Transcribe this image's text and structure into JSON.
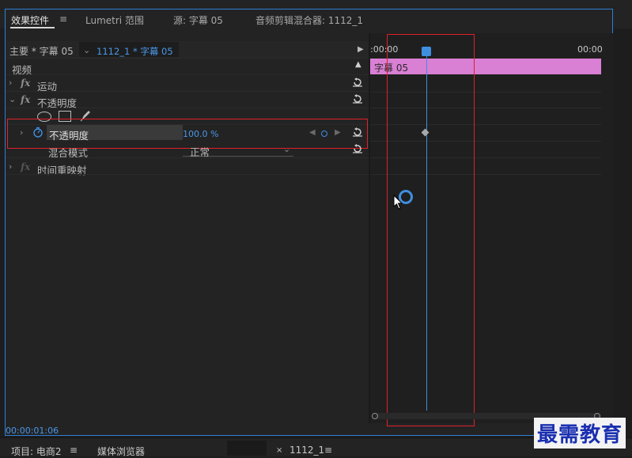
{
  "tabs": {
    "effect_controls": "效果控件",
    "lumetri": "Lumetri 范围",
    "source": "源: 字幕 05",
    "audio_mixer": "音频剪辑混合器: 1112_1",
    "menu_icon": "≡"
  },
  "source_header": {
    "master": "主要 * 字幕 05",
    "sequence": "1112_1 * 字幕 05"
  },
  "timeline": {
    "time_start": ":00:00",
    "time_end": "00:00",
    "clip_label": "字幕 05"
  },
  "effects": {
    "video_header": "视频",
    "motion": "运动",
    "opacity": "不透明度",
    "opacity_param": "不透明度",
    "opacity_value": "100.0 %",
    "blend_mode_label": "混合模式",
    "blend_mode_value": "正常",
    "time_remap": "时间重映射"
  },
  "status": {
    "timecode": "00:00:01:06"
  },
  "bottom_tabs": {
    "project": "项目: 电商2",
    "media_browser": "媒体浏览器",
    "sequence": "1112_1",
    "close": "×"
  },
  "watermark": "最需教育",
  "colors": {
    "accent": "#2f7fd6",
    "clip": "#d97fd4",
    "playhead": "#3f8fe0",
    "highlight_box": "#e0202a"
  }
}
